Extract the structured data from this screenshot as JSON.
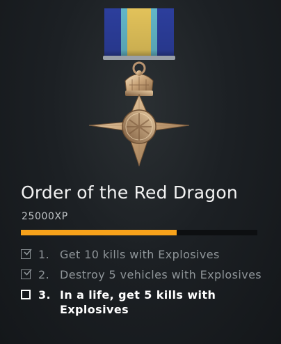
{
  "award": {
    "title": "Order of the Red Dragon",
    "xp": "25000XP",
    "progress": 0.66,
    "ribbon_colors": [
      "#2c3e9c",
      "#62b6c8",
      "#e2c25a"
    ],
    "medal_icon": "star-cross-medal"
  },
  "objectives": [
    {
      "number": "1.",
      "text": "Get 10 kills with Explosives",
      "completed": true
    },
    {
      "number": "2.",
      "text": "Destroy 5 vehicles with Explosives",
      "completed": true
    },
    {
      "number": "3.",
      "text": "In a life, get 5 kills with Explosives",
      "completed": false
    }
  ],
  "colors": {
    "accent": "#f7a21b",
    "completed_text": "#8f9599",
    "active_text": "#ffffff"
  }
}
